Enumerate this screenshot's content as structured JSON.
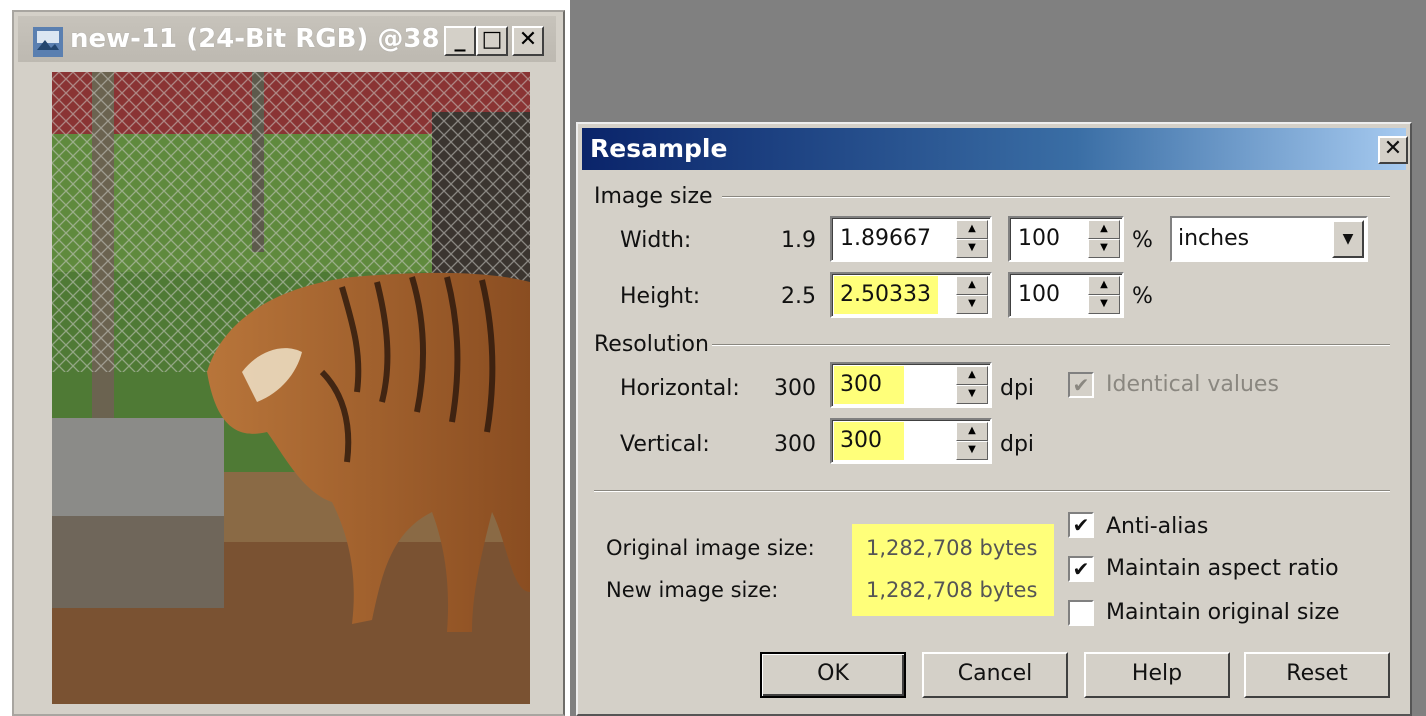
{
  "image_window": {
    "title": "new-11 (24-Bit RGB) @38% ...",
    "minimize_label": "_",
    "maximize_label": "□",
    "close_label": "✕",
    "photo_description": "tiger"
  },
  "dialog": {
    "title": "Resample",
    "close_label": "✕",
    "image_size": {
      "group_label": "Image size",
      "width": {
        "label": "Width:",
        "current": "1.9",
        "value": "1.89667",
        "percent": "100",
        "percent_sign": "%"
      },
      "height": {
        "label": "Height:",
        "current": "2.5",
        "value": "2.50333",
        "percent": "100",
        "percent_sign": "%"
      },
      "units": "inches"
    },
    "resolution": {
      "group_label": "Resolution",
      "horizontal": {
        "label": "Horizontal:",
        "current": "300",
        "value": "300",
        "unit": "dpi"
      },
      "vertical": {
        "label": "Vertical:",
        "current": "300",
        "value": "300",
        "unit": "dpi"
      },
      "identical_values": {
        "label": "Identical values",
        "checked": true,
        "enabled": false
      }
    },
    "size_info": {
      "original_label": "Original image size:",
      "original_value": "1,282,708 bytes",
      "new_label": "New image size:",
      "new_value": "1,282,708 bytes"
    },
    "options": {
      "anti_alias": {
        "label": "Anti-alias",
        "checked": true
      },
      "maintain_aspect": {
        "label": "Maintain aspect ratio",
        "checked": true
      },
      "maintain_original": {
        "label": "Maintain original size",
        "checked": false
      }
    },
    "buttons": {
      "ok": "OK",
      "cancel": "Cancel",
      "help": "Help",
      "reset": "Reset"
    },
    "highlight_color": "#ffff7a"
  }
}
